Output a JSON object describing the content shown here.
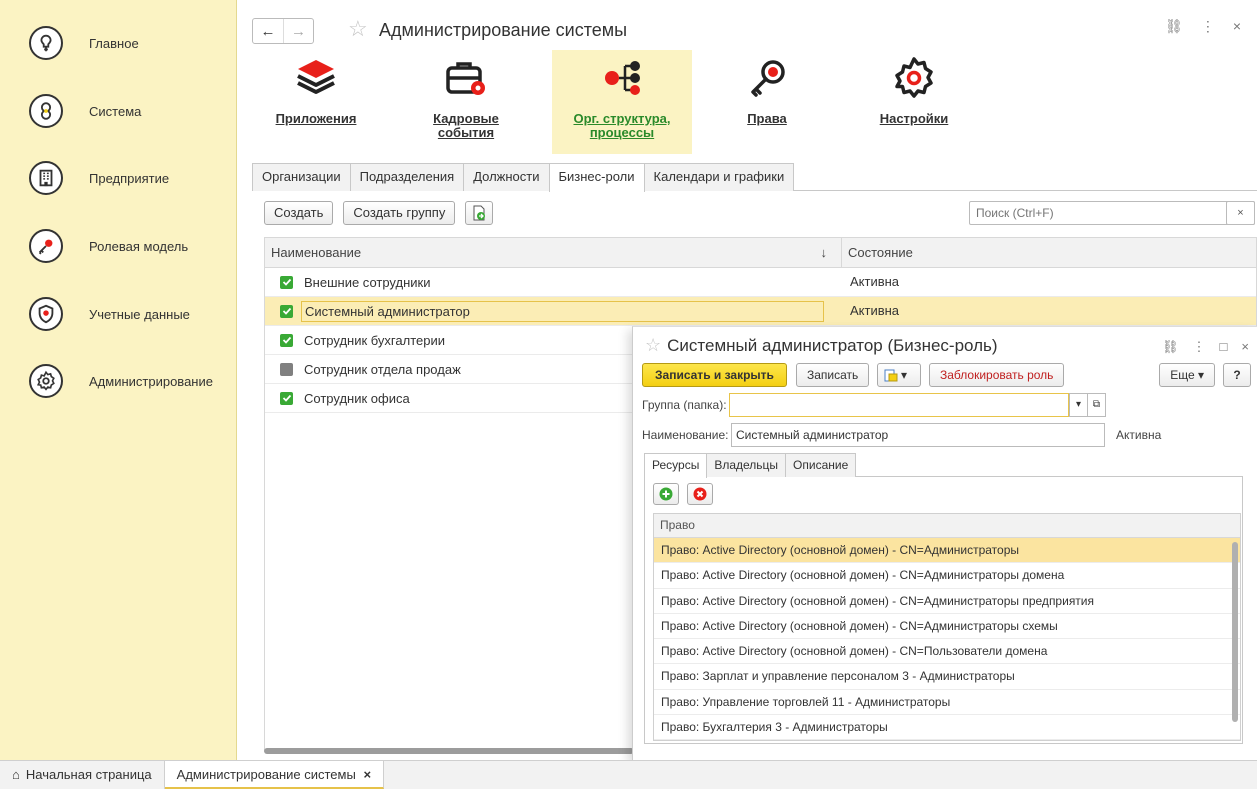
{
  "sidebar": {
    "items": [
      {
        "label": "Главное",
        "icon": "lightbulb-icon"
      },
      {
        "label": "Система",
        "icon": "system-icon"
      },
      {
        "label": "Предприятие",
        "icon": "building-icon"
      },
      {
        "label": "Ролевая модель",
        "icon": "key-icon"
      },
      {
        "label": "Учетные данные",
        "icon": "shield-icon"
      },
      {
        "label": "Администрирование",
        "icon": "gear-icon"
      }
    ]
  },
  "header": {
    "title": "Администрирование системы",
    "back": "←",
    "forward": "→",
    "star": "☆",
    "link_icon": "⛓",
    "more_icon": "⋮",
    "close_icon": "×"
  },
  "toolbar": {
    "items": [
      {
        "label": "Приложения",
        "icon": "layers-icon"
      },
      {
        "label": "Кадровые события",
        "icon": "briefcase-gear-icon"
      },
      {
        "label": "Орг. структура, процессы",
        "icon": "org-structure-icon",
        "active": true
      },
      {
        "label": "Права",
        "icon": "key-icon"
      },
      {
        "label": "Настройки",
        "icon": "gear-icon"
      }
    ]
  },
  "tabs": [
    "Организации",
    "Подразделения",
    "Должности",
    "Бизнес-роли",
    "Календари и графики"
  ],
  "active_tab": "Бизнес-роли",
  "commands": {
    "create": "Создать",
    "create_group": "Создать группу",
    "search_placeholder": "Поиск (Ctrl+F)",
    "search_clear": "×"
  },
  "grid": {
    "columns": {
      "name": "Наименование",
      "state": "Состояние",
      "sort": "↓"
    },
    "rows": [
      {
        "name": "Внешние сотрудники",
        "state": "Активна",
        "checked": true
      },
      {
        "name": "Системный администратор",
        "state": "Активна",
        "checked": true,
        "selected": true
      },
      {
        "name": "Сотрудник бухгалтерии",
        "state": "",
        "checked": true
      },
      {
        "name": "Сотрудник отдела продаж",
        "state": "",
        "checked": false
      },
      {
        "name": "Сотрудник офиса",
        "state": "",
        "checked": true
      }
    ]
  },
  "modal": {
    "title": "Системный администратор (Бизнес-роль)",
    "star": "☆",
    "link_icon": "⛓",
    "more_icon": "⋮",
    "maximize_icon": "□",
    "close_icon": "×",
    "save_close": "Записать и закрыть",
    "save": "Записать",
    "report_arrow": "▾",
    "block": "Заблокировать роль",
    "more": "Еще ▾",
    "help": "?",
    "group_label": "Группа (папка):",
    "group_value": "",
    "dropdown_arrow": "▾",
    "open_icon": "⧉",
    "name_label": "Наименование:",
    "name_value": "Системный администратор",
    "status": "Активна",
    "tabs": [
      "Ресурсы",
      "Владельцы",
      "Описание"
    ],
    "active_tab": "Ресурсы",
    "grid_header": "Право",
    "rights": [
      "Право: Active Directory (основной домен) - CN=Администраторы",
      "Право: Active Directory (основной домен) - CN=Администраторы домена",
      "Право: Active Directory (основной домен) - CN=Администраторы предприятия",
      "Право: Active Directory (основной домен) - CN=Администраторы схемы",
      "Право: Active Directory (основной домен) - CN=Пользователи домена",
      "Право: Зарплат и управление персоналом 3 - Администраторы",
      "Право: Управление торговлей 11 - Администраторы",
      "Право: Бухгалтерия 3 - Администраторы"
    ]
  },
  "bottombar": {
    "home": "Начальная страница",
    "home_icon": "⌂",
    "current": "Администрирование системы",
    "current_close": "×"
  },
  "colors": {
    "sidebar_bg": "#fbf3c3",
    "accent_yellow": "#f4cf12",
    "check_green": "#39a935",
    "link_green": "#2a8a2a",
    "danger_red": "#c02020"
  }
}
